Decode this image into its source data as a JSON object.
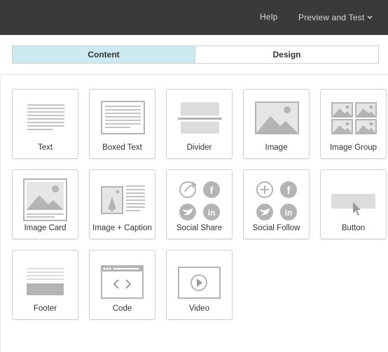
{
  "topbar": {
    "help_label": "Help",
    "preview_label": "Preview and Test",
    "chevron_icon": "chevron-down-icon"
  },
  "tabs": [
    {
      "label": "Content",
      "active": true
    },
    {
      "label": "Design",
      "active": false
    }
  ],
  "blocks": [
    {
      "label": "Text",
      "icon": "text-icon"
    },
    {
      "label": "Boxed Text",
      "icon": "boxed-text-icon"
    },
    {
      "label": "Divider",
      "icon": "divider-icon"
    },
    {
      "label": "Image",
      "icon": "image-icon"
    },
    {
      "label": "Image Group",
      "icon": "image-group-icon"
    },
    {
      "label": "Image Card",
      "icon": "image-card-icon"
    },
    {
      "label": "Image + Caption",
      "icon": "image-caption-icon"
    },
    {
      "label": "Social Share",
      "icon": "social-share-icon"
    },
    {
      "label": "Social Follow",
      "icon": "social-follow-icon"
    },
    {
      "label": "Button",
      "icon": "button-icon"
    },
    {
      "label": "Footer",
      "icon": "footer-icon"
    },
    {
      "label": "Code",
      "icon": "code-icon"
    },
    {
      "label": "Video",
      "icon": "video-icon"
    }
  ],
  "colors": {
    "topbar_bg": "#3a3a3a",
    "active_tab_bg": "#cde9f2",
    "icon_gray": "#b4b4b4",
    "icon_light": "#dcdcdc"
  }
}
